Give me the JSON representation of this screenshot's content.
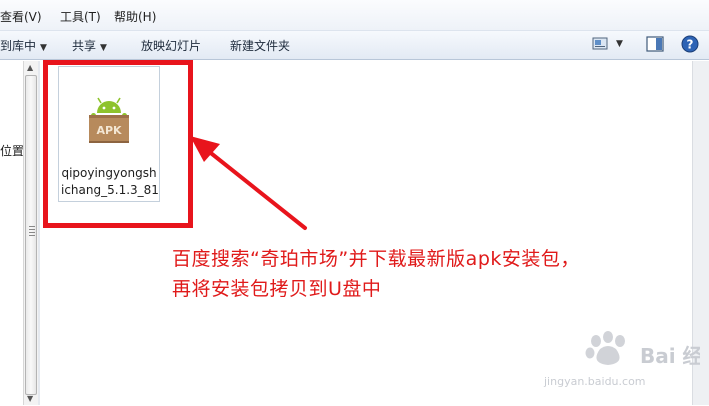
{
  "menubar": {
    "items": [
      {
        "label": "查看(V)"
      },
      {
        "label": "工具(T)"
      },
      {
        "label": "帮助(H)"
      }
    ]
  },
  "toolbar": {
    "include_library": "到库中",
    "share": "共享",
    "slideshow": "放映幻灯片",
    "new_folder": "新建文件夹"
  },
  "navpane": {
    "partial_label": "位置"
  },
  "file": {
    "icon": "apk-icon",
    "icon_label": "APK",
    "name_line1": "qipoyingyongsh",
    "name_line2": "ichang_5.1.3_81"
  },
  "annotation": {
    "line1": "百度搜索“奇珀市场”并下载最新版apk安装包，",
    "line2": "再将安装包拷贝到U盘中"
  },
  "watermark": {
    "brand": "Bai 经验",
    "url": "jingyan.baidu.com"
  },
  "colors": {
    "highlight": "#e8141c",
    "annotation_text": "#e01a1a",
    "apk_box": "#b78a5c",
    "android_green": "#8ec32c"
  }
}
